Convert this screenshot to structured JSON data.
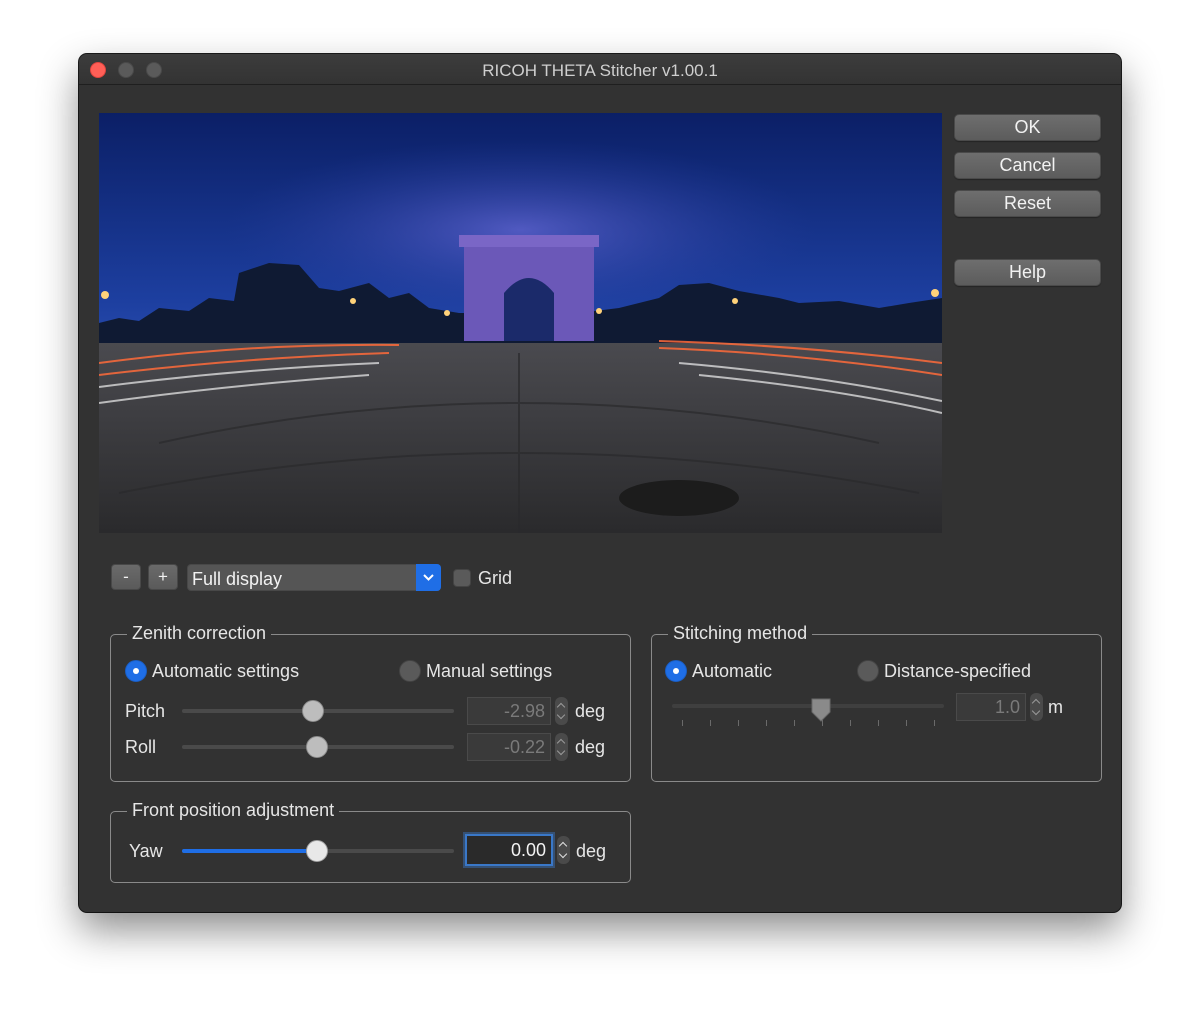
{
  "window": {
    "title": "RICOH THETA Stitcher v1.00.1"
  },
  "side_buttons": {
    "ok": "OK",
    "cancel": "Cancel",
    "reset": "Reset",
    "help": "Help"
  },
  "toolbar": {
    "zoom_out": "-",
    "zoom_in": "+",
    "display_mode": "Full display",
    "grid_label": "Grid",
    "grid_checked": false
  },
  "zenith": {
    "title": "Zenith correction",
    "auto_label": "Automatic settings",
    "manual_label": "Manual settings",
    "selected": "Automatic settings",
    "pitch": {
      "label": "Pitch",
      "value": "-2.98",
      "unit": "deg",
      "slider_fraction": 0.48
    },
    "roll": {
      "label": "Roll",
      "value": "-0.22",
      "unit": "deg",
      "slider_fraction": 0.5
    }
  },
  "front": {
    "title": "Front position adjustment",
    "yaw": {
      "label": "Yaw",
      "value": "0.00",
      "unit": "deg",
      "slider_fraction": 0.5
    }
  },
  "stitching": {
    "title": "Stitching method",
    "auto_label": "Automatic",
    "distance_label": "Distance-specified",
    "selected": "Automatic",
    "distance": {
      "value": "1.0",
      "unit": "m",
      "slider_fraction": 0.55
    }
  },
  "colors": {
    "accent": "#1f6ee6",
    "window_bg": "#323232"
  }
}
